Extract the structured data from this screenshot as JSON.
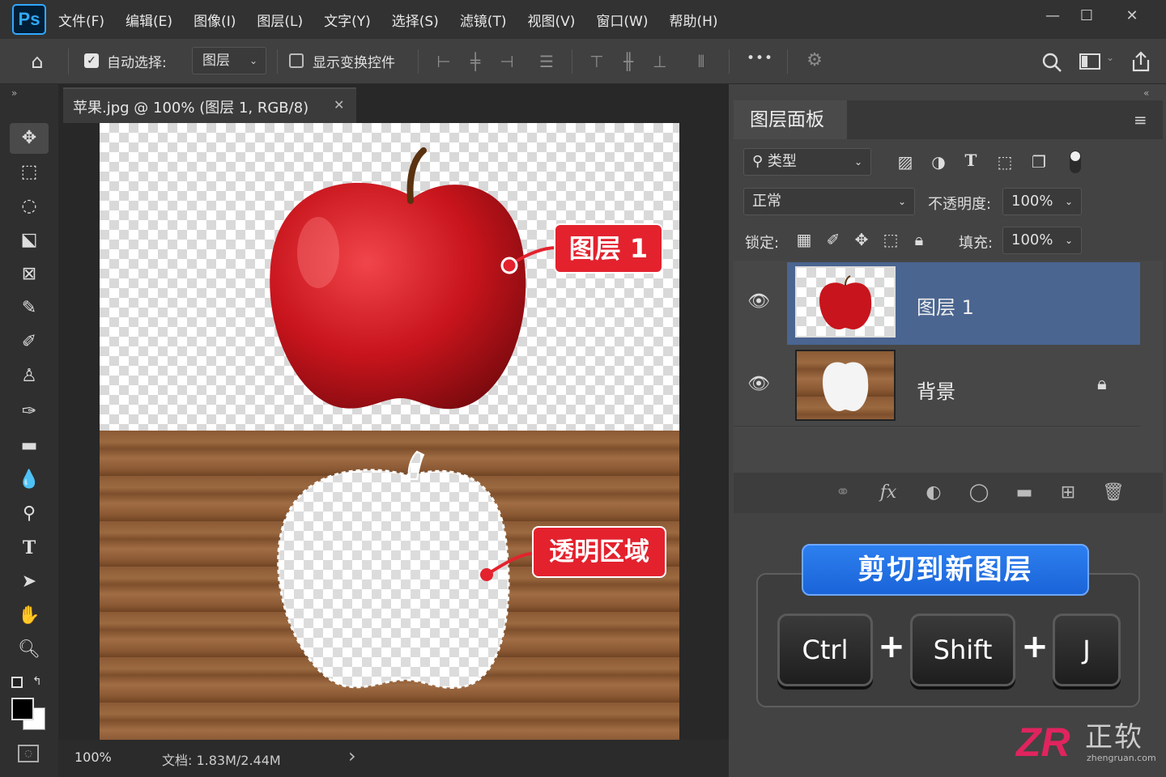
{
  "app": {
    "logo": "Ps"
  },
  "menu": [
    "文件(F)",
    "编辑(E)",
    "图像(I)",
    "图层(L)",
    "文字(Y)",
    "选择(S)",
    "滤镜(T)",
    "视图(V)",
    "窗口(W)",
    "帮助(H)"
  ],
  "window_controls": {
    "minimize": "—",
    "maximize": "☐",
    "close": "✕"
  },
  "options_bar": {
    "auto_select_label": "自动选择:",
    "auto_select_checked": true,
    "auto_select_target": "图层",
    "show_transform_label": "显示变换控件",
    "show_transform_checked": false,
    "more": "•••"
  },
  "document": {
    "tab_title": "苹果.jpg @ 100% (图层 1, RGB/8)",
    "tab_close": "✕",
    "callout_layer": "图层 1",
    "callout_transparent": "透明区域",
    "status_zoom": "100%",
    "status_doc": "文档: 1.83M/2.44M",
    "status_arrow": "›"
  },
  "layers_panel": {
    "title": "图层面板",
    "filter_label": "类型",
    "blend_mode": "正常",
    "opacity_label": "不透明度:",
    "opacity_value": "100%",
    "lock_label": "锁定:",
    "fill_label": "填充:",
    "fill_value": "100%",
    "layers": [
      {
        "name": "图层 1",
        "selected": true,
        "visible": true,
        "locked": false
      },
      {
        "name": "背景",
        "selected": false,
        "visible": true,
        "locked": true
      }
    ]
  },
  "shortcut": {
    "title": "剪切到新图层",
    "keys": [
      "Ctrl",
      "Shift",
      "J"
    ],
    "plus": "+"
  },
  "watermark": {
    "mark": "ZR",
    "name": "正软",
    "url": "zhengruan.com"
  },
  "colors": {
    "accent_red": "#e3222e",
    "banner_blue": "#1a64d8",
    "selected_layer": "#4a6590",
    "logo_pink": "#e0245e"
  }
}
